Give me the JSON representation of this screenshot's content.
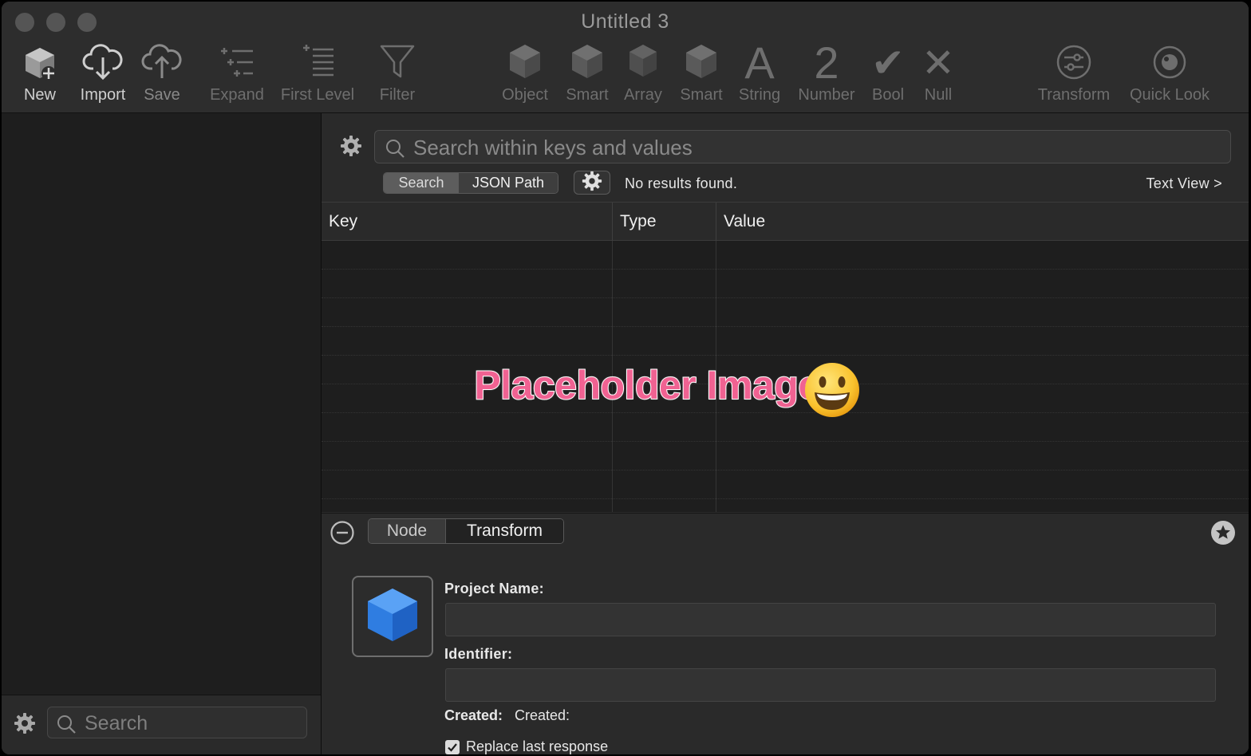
{
  "window": {
    "title": "Untitled 3"
  },
  "toolbar": {
    "new": "New",
    "import": "Import",
    "save": "Save",
    "expand": "Expand",
    "first_level": "First Level",
    "filter": "Filter",
    "object": "Object",
    "smart1": "Smart",
    "array": "Array",
    "smart2": "Smart",
    "string": "String",
    "string_glyph": "A",
    "number": "Number",
    "number_glyph": "2",
    "bool": "Bool",
    "bool_glyph": "✔",
    "null": "Null",
    "null_glyph": "✕",
    "transform": "Transform",
    "quick_look": "Quick Look"
  },
  "sidebar": {
    "search_placeholder": "Search"
  },
  "search": {
    "placeholder": "Search within keys and values",
    "modes": [
      "Search",
      "JSON Path"
    ],
    "status": "No results found.",
    "text_view": "Text View >"
  },
  "table": {
    "columns": [
      "Key",
      "Type",
      "Value"
    ],
    "rows": []
  },
  "overlay": {
    "text": "Placeholder Image"
  },
  "inspector": {
    "tabs": [
      "Node",
      "Transform"
    ],
    "project_name_label": "Project Name:",
    "project_name_value": "",
    "identifier_label": "Identifier:",
    "identifier_value": "",
    "created_label": "Created:",
    "created_value": "Created:",
    "replace_label": "Replace last response",
    "replace_checked": true
  },
  "colors": {
    "accent_blue": "#2f7de1",
    "window_bg": "#2b2b2b",
    "overlay_pink": "#f06292"
  }
}
